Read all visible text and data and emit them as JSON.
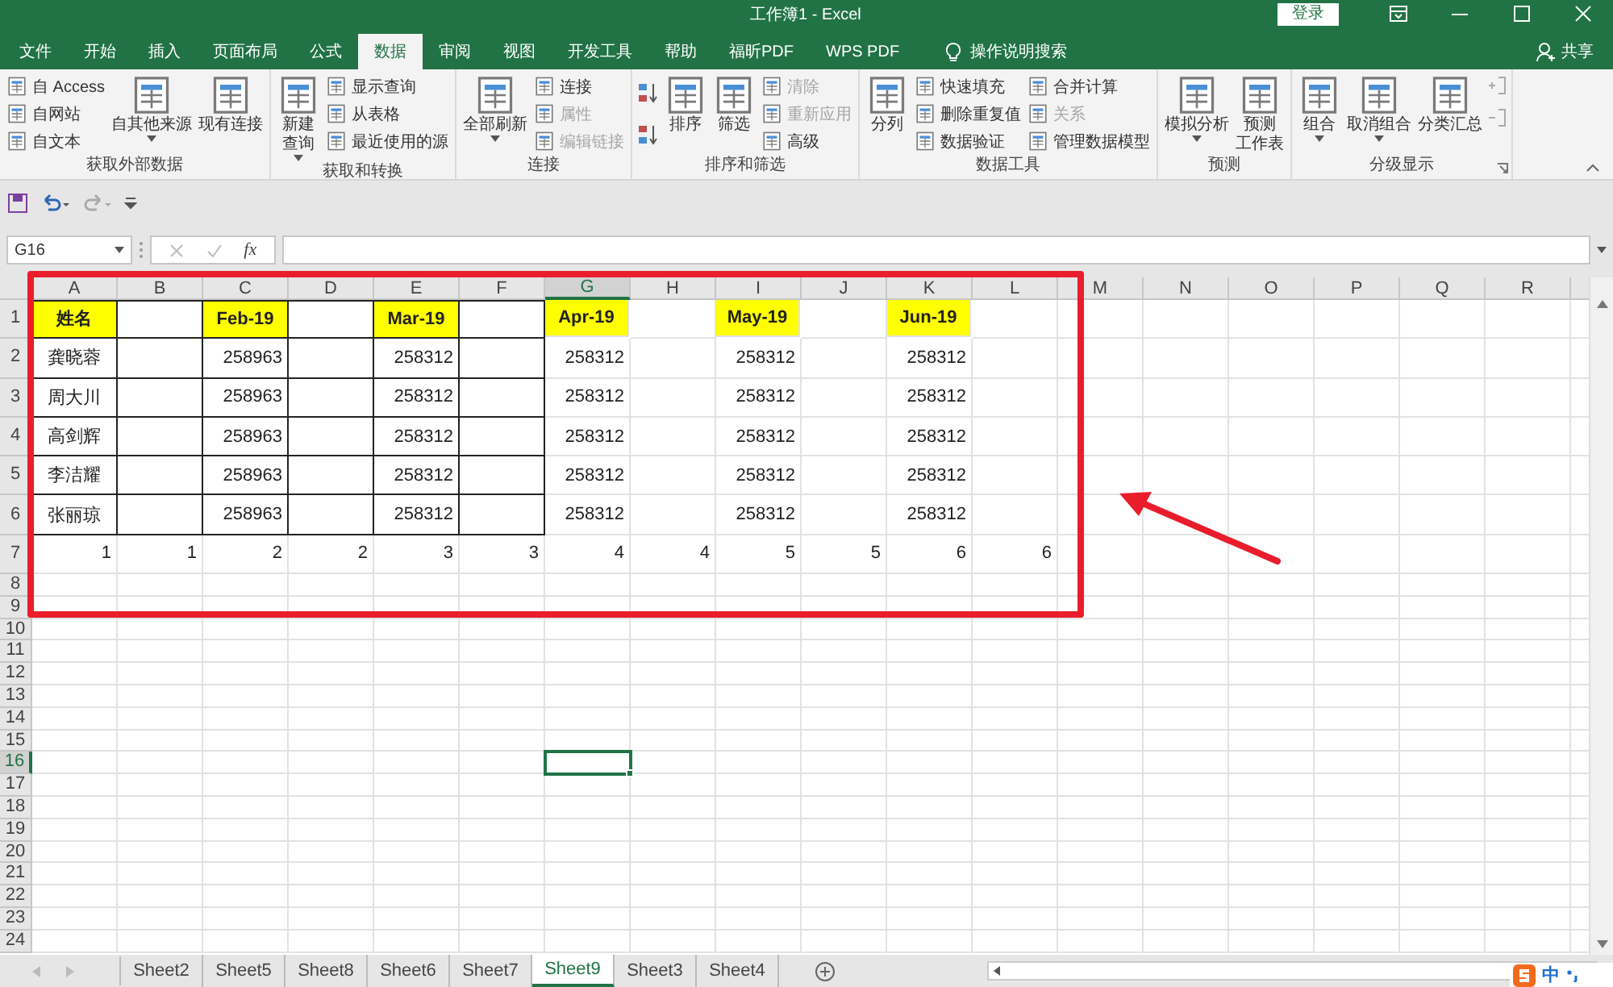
{
  "window": {
    "title": "工作簿1 - Excel",
    "sign_in": "登录"
  },
  "tabs": [
    {
      "label": "文件",
      "selected": false
    },
    {
      "label": "开始",
      "selected": false
    },
    {
      "label": "插入",
      "selected": false
    },
    {
      "label": "页面布局",
      "selected": false
    },
    {
      "label": "公式",
      "selected": false
    },
    {
      "label": "数据",
      "selected": true
    },
    {
      "label": "审阅",
      "selected": false
    },
    {
      "label": "视图",
      "selected": false
    },
    {
      "label": "开发工具",
      "selected": false
    },
    {
      "label": "帮助",
      "selected": false
    },
    {
      "label": "福昕PDF",
      "selected": false
    },
    {
      "label": "WPS PDF",
      "selected": false
    }
  ],
  "tell_me": "操作说明搜索",
  "share": "共享",
  "ribbon": {
    "groups": [
      {
        "label": "获取外部数据",
        "launcher": false,
        "controls": [
          {
            "kind": "stack",
            "items": [
              {
                "label": "自 Access",
                "disabled": false
              },
              {
                "label": "自网站",
                "disabled": false
              },
              {
                "label": "自文本",
                "disabled": false
              }
            ]
          },
          {
            "kind": "large",
            "lines": [
              "自其他来源"
            ],
            "dropdown": true,
            "disabled": false
          },
          {
            "kind": "large",
            "lines": [
              "现有连接"
            ],
            "dropdown": false,
            "disabled": false
          }
        ]
      },
      {
        "label": "获取和转换",
        "launcher": false,
        "controls": [
          {
            "kind": "large",
            "lines": [
              "新建",
              "查询"
            ],
            "dropdown": true,
            "disabled": false
          },
          {
            "kind": "stack",
            "items": [
              {
                "label": "显示查询",
                "disabled": false
              },
              {
                "label": "从表格",
                "disabled": false
              },
              {
                "label": "最近使用的源",
                "disabled": false
              }
            ]
          }
        ]
      },
      {
        "label": "连接",
        "launcher": false,
        "controls": [
          {
            "kind": "large",
            "lines": [
              "全部刷新"
            ],
            "dropdown": true,
            "disabled": false
          },
          {
            "kind": "stack",
            "items": [
              {
                "label": "连接",
                "disabled": false
              },
              {
                "label": "属性",
                "disabled": true
              },
              {
                "label": "编辑链接",
                "disabled": true
              }
            ]
          }
        ]
      },
      {
        "label": "排序和筛选",
        "launcher": false,
        "controls": [
          {
            "kind": "sort_icons"
          },
          {
            "kind": "large",
            "lines": [
              "排序"
            ],
            "dropdown": false,
            "disabled": false
          },
          {
            "kind": "large",
            "lines": [
              "筛选"
            ],
            "dropdown": false,
            "disabled": false
          },
          {
            "kind": "stack",
            "items": [
              {
                "label": "清除",
                "disabled": true
              },
              {
                "label": "重新应用",
                "disabled": true
              },
              {
                "label": "高级",
                "disabled": false
              }
            ]
          }
        ]
      },
      {
        "label": "数据工具",
        "launcher": false,
        "controls": [
          {
            "kind": "large",
            "lines": [
              "分列"
            ],
            "dropdown": false,
            "disabled": false
          },
          {
            "kind": "stack",
            "items": [
              {
                "label": "快速填充",
                "disabled": false
              },
              {
                "label": "删除重复值",
                "disabled": false
              },
              {
                "label": "数据验证",
                "disabled": false
              }
            ]
          },
          {
            "kind": "stack",
            "items": [
              {
                "label": "合并计算",
                "disabled": false
              },
              {
                "label": "关系",
                "disabled": true
              },
              {
                "label": "管理数据模型",
                "disabled": false
              }
            ]
          }
        ]
      },
      {
        "label": "预测",
        "launcher": false,
        "controls": [
          {
            "kind": "large",
            "lines": [
              "模拟分析"
            ],
            "dropdown": true,
            "disabled": false
          },
          {
            "kind": "large",
            "lines": [
              "预测",
              "工作表"
            ],
            "dropdown": false,
            "disabled": false
          }
        ]
      },
      {
        "label": "分级显示",
        "launcher": true,
        "controls": [
          {
            "kind": "large",
            "lines": [
              "组合"
            ],
            "dropdown": true,
            "disabled": false
          },
          {
            "kind": "large",
            "lines": [
              "取消组合"
            ],
            "dropdown": true,
            "disabled": false
          },
          {
            "kind": "large",
            "lines": [
              "分类汇总"
            ],
            "dropdown": false,
            "disabled": false
          },
          {
            "kind": "outline_icons"
          }
        ]
      }
    ]
  },
  "formula_bar": {
    "name_box": "G16",
    "fx": "fx"
  },
  "sheet": {
    "columns": [
      {
        "label": "A",
        "selected": false
      },
      {
        "label": "B",
        "selected": false
      },
      {
        "label": "C",
        "selected": false
      },
      {
        "label": "D",
        "selected": false
      },
      {
        "label": "E",
        "selected": false
      },
      {
        "label": "F",
        "selected": false
      },
      {
        "label": "G",
        "selected": true
      },
      {
        "label": "H",
        "selected": false
      },
      {
        "label": "I",
        "selected": false
      },
      {
        "label": "J",
        "selected": false
      },
      {
        "label": "K",
        "selected": false
      },
      {
        "label": "L",
        "selected": false
      },
      {
        "label": "M",
        "selected": false
      },
      {
        "label": "N",
        "selected": false
      },
      {
        "label": "O",
        "selected": false
      },
      {
        "label": "P",
        "selected": false
      },
      {
        "label": "Q",
        "selected": false
      },
      {
        "label": "R",
        "selected": false
      }
    ],
    "rows": [
      {
        "label": "1",
        "selected": false,
        "cells": [
          {
            "text": "姓名",
            "kind": "header",
            "bordered": true
          },
          {
            "bordered": true
          },
          {
            "text": "Feb-19",
            "kind": "header",
            "bordered": true
          },
          {
            "bordered": true
          },
          {
            "text": "Mar-19",
            "kind": "header",
            "bordered": true
          },
          {
            "bordered": true
          },
          {
            "text": "Apr-19",
            "kind": "header",
            "bordered": false
          },
          {
            "bordered": false
          },
          {
            "text": "May-19",
            "kind": "header",
            "bordered": false
          },
          {
            "bordered": false
          },
          {
            "text": "Jun-19",
            "kind": "header",
            "bordered": false
          }
        ]
      },
      {
        "label": "2",
        "selected": false,
        "cells": [
          {
            "text": "龚晓蓉",
            "kind": "text",
            "bordered": true
          },
          {
            "bordered": true
          },
          {
            "text": "258963",
            "kind": "number",
            "bordered": true
          },
          {
            "bordered": true
          },
          {
            "text": "258312",
            "kind": "number",
            "bordered": true
          },
          {
            "bordered": true
          },
          {
            "text": "258312",
            "kind": "number",
            "bordered": false
          },
          {
            "bordered": false
          },
          {
            "text": "258312",
            "kind": "number",
            "bordered": false
          },
          {
            "bordered": false
          },
          {
            "text": "258312",
            "kind": "number",
            "bordered": false
          }
        ]
      },
      {
        "label": "3",
        "selected": false,
        "cells": [
          {
            "text": "周大川",
            "kind": "text",
            "bordered": true
          },
          {
            "bordered": true
          },
          {
            "text": "258963",
            "kind": "number",
            "bordered": true
          },
          {
            "bordered": true
          },
          {
            "text": "258312",
            "kind": "number",
            "bordered": true
          },
          {
            "bordered": true
          },
          {
            "text": "258312",
            "kind": "number",
            "bordered": false
          },
          {
            "bordered": false
          },
          {
            "text": "258312",
            "kind": "number",
            "bordered": false
          },
          {
            "bordered": false
          },
          {
            "text": "258312",
            "kind": "number",
            "bordered": false
          }
        ]
      },
      {
        "label": "4",
        "selected": false,
        "cells": [
          {
            "text": "高剑辉",
            "kind": "text",
            "bordered": true
          },
          {
            "bordered": true
          },
          {
            "text": "258963",
            "kind": "number",
            "bordered": true
          },
          {
            "bordered": true
          },
          {
            "text": "258312",
            "kind": "number",
            "bordered": true
          },
          {
            "bordered": true
          },
          {
            "text": "258312",
            "kind": "number",
            "bordered": false
          },
          {
            "bordered": false
          },
          {
            "text": "258312",
            "kind": "number",
            "bordered": false
          },
          {
            "bordered": false
          },
          {
            "text": "258312",
            "kind": "number",
            "bordered": false
          }
        ]
      },
      {
        "label": "5",
        "selected": false,
        "cells": [
          {
            "text": "李洁耀",
            "kind": "text",
            "bordered": true
          },
          {
            "bordered": true
          },
          {
            "text": "258963",
            "kind": "number",
            "bordered": true
          },
          {
            "bordered": true
          },
          {
            "text": "258312",
            "kind": "number",
            "bordered": true
          },
          {
            "bordered": true
          },
          {
            "text": "258312",
            "kind": "number",
            "bordered": false
          },
          {
            "bordered": false
          },
          {
            "text": "258312",
            "kind": "number",
            "bordered": false
          },
          {
            "bordered": false
          },
          {
            "text": "258312",
            "kind": "number",
            "bordered": false
          }
        ]
      },
      {
        "label": "6",
        "selected": false,
        "cells": [
          {
            "text": "张丽琼",
            "kind": "text",
            "bordered": true
          },
          {
            "bordered": true
          },
          {
            "text": "258963",
            "kind": "number",
            "bordered": true
          },
          {
            "bordered": true
          },
          {
            "text": "258312",
            "kind": "number",
            "bordered": true
          },
          {
            "bordered": true
          },
          {
            "text": "258312",
            "kind": "number",
            "bordered": false
          },
          {
            "bordered": false
          },
          {
            "text": "258312",
            "kind": "number",
            "bordered": false
          },
          {
            "bordered": false
          },
          {
            "text": "258312",
            "kind": "number",
            "bordered": false
          }
        ]
      },
      {
        "label": "7",
        "selected": false,
        "cells": [
          {
            "text": "1",
            "kind": "number",
            "bordered": false
          },
          {
            "text": "1",
            "kind": "number",
            "bordered": false
          },
          {
            "text": "2",
            "kind": "number",
            "bordered": false
          },
          {
            "text": "2",
            "kind": "number",
            "bordered": false
          },
          {
            "text": "3",
            "kind": "number",
            "bordered": false
          },
          {
            "text": "3",
            "kind": "number",
            "bordered": false
          },
          {
            "text": "4",
            "kind": "number",
            "bordered": false
          },
          {
            "text": "4",
            "kind": "number",
            "bordered": false
          },
          {
            "text": "5",
            "kind": "number",
            "bordered": false
          },
          {
            "text": "5",
            "kind": "number",
            "bordered": false
          },
          {
            "text": "6",
            "kind": "number",
            "bordered": false
          },
          {
            "text": "6",
            "kind": "number",
            "bordered": false
          }
        ]
      },
      {
        "label": "8",
        "selected": false
      },
      {
        "label": "9",
        "selected": false
      },
      {
        "label": "10",
        "selected": false
      },
      {
        "label": "11",
        "selected": false
      },
      {
        "label": "12",
        "selected": false
      },
      {
        "label": "13",
        "selected": false
      },
      {
        "label": "14",
        "selected": false
      },
      {
        "label": "15",
        "selected": false
      },
      {
        "label": "16",
        "selected": true
      },
      {
        "label": "17",
        "selected": false
      },
      {
        "label": "18",
        "selected": false
      },
      {
        "label": "19",
        "selected": false
      },
      {
        "label": "20",
        "selected": false
      },
      {
        "label": "21",
        "selected": false
      },
      {
        "label": "22",
        "selected": false
      },
      {
        "label": "23",
        "selected": false
      },
      {
        "label": "24",
        "selected": false
      }
    ]
  },
  "sheet_tabs": [
    {
      "label": "Sheet2",
      "selected": false
    },
    {
      "label": "Sheet5",
      "selected": false
    },
    {
      "label": "Sheet8",
      "selected": false
    },
    {
      "label": "Sheet6",
      "selected": false
    },
    {
      "label": "Sheet7",
      "selected": false
    },
    {
      "label": "Sheet9",
      "selected": true
    },
    {
      "label": "Sheet3",
      "selected": false
    },
    {
      "label": "Sheet4",
      "selected": false
    }
  ],
  "ime": {
    "label": "中"
  }
}
